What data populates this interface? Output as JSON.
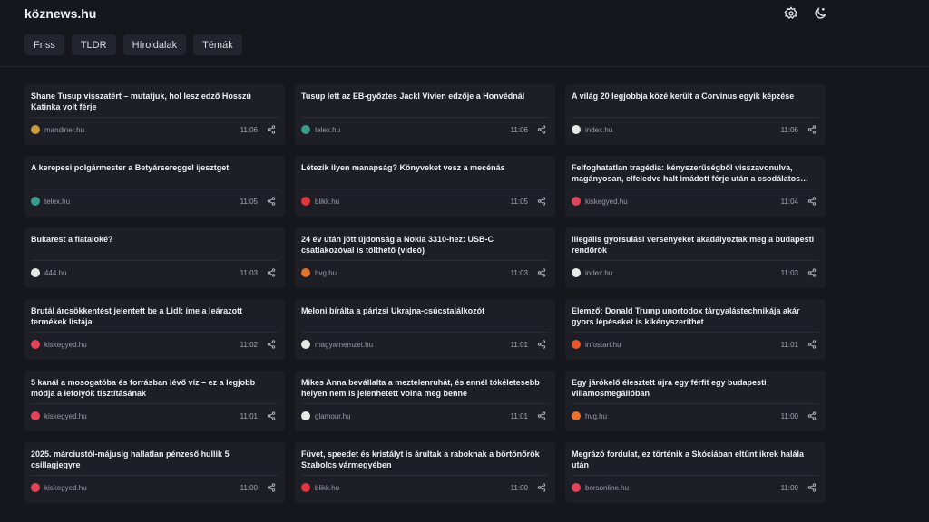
{
  "header": {
    "logo": "köznews.hu",
    "icons": [
      "settings-icon",
      "theme-toggle-icon"
    ]
  },
  "tabs": [
    {
      "label": "Friss"
    },
    {
      "label": "TLDR"
    },
    {
      "label": "Híroldalak"
    },
    {
      "label": "Témák"
    }
  ],
  "source_colors": {
    "mandiner.hu": "#c99a3a",
    "telex.hu": "#3a9b8c",
    "index.hu": "#e8e8e8",
    "blikk.hu": "#e0353b",
    "kiskegyed.hu": "#e0445a",
    "444.hu": "#e8e8e8",
    "hvg.hu": "#e8702a",
    "magyarnemzet.hu": "#e8e8e8",
    "infostart.hu": "#e8572a",
    "glamour.hu": "#e8e8e8",
    "borsonline.hu": "#e0445a"
  },
  "articles": [
    {
      "title": "Shane Tusup visszatért – mutatjuk, hol lesz edző Hosszú Katinka volt férje",
      "source": "mandiner.hu",
      "time": "11:06"
    },
    {
      "title": "Tusup lett az EB-győztes Jackl Vivien edzője a Honvédnál",
      "source": "telex.hu",
      "time": "11:06"
    },
    {
      "title": "A világ 20 legjobbja közé került a Corvinus egyik képzése",
      "source": "index.hu",
      "time": "11:06"
    },
    {
      "title": "A kerepesi polgármester a Betyársereggel ijesztget",
      "source": "telex.hu",
      "time": "11:05"
    },
    {
      "title": "Létezik ilyen manapság? Könyveket vesz a mecénás",
      "source": "blikk.hu",
      "time": "11:05"
    },
    {
      "title": "Felfoghatatlan tragédia: kényszerűségből visszavonulva, magányosan, elfeledve halt imádott férje után a csodálatos…",
      "source": "kiskegyed.hu",
      "time": "11:04"
    },
    {
      "title": "Bukarest a fiataloké?",
      "source": "444.hu",
      "time": "11:03"
    },
    {
      "title": "24 év után jött újdonság a Nokia 3310-hez: USB-C csatlakozóval is tölthető (videó)",
      "source": "hvg.hu",
      "time": "11:03"
    },
    {
      "title": "Illegális gyorsulási versenyeket akadályoztak meg a budapesti rendőrök",
      "source": "index.hu",
      "time": "11:03"
    },
    {
      "title": "Brutál árcsökkentést jelentett be a Lidl: íme a leárazott termékek listája",
      "source": "kiskegyed.hu",
      "time": "11:02"
    },
    {
      "title": "Meloni bírálta a párizsi Ukrajna-csúcstalálkozót",
      "source": "magyarnemzet.hu",
      "time": "11:01"
    },
    {
      "title": "Elemző: Donald Trump unortodox tárgyalástechnikája akár gyors lépéseket is kikényszeríthet",
      "source": "infostart.hu",
      "time": "11:01"
    },
    {
      "title": "5 kanál a mosogatóba és forrásban lévő víz – ez a legjobb módja a lefolyók tisztításának",
      "source": "kiskegyed.hu",
      "time": "11:01"
    },
    {
      "title": "Mikes Anna bevállalta a meztelenruhát, és ennél tökéletesebb helyen nem is jelenhetett volna meg benne",
      "source": "glamour.hu",
      "time": "11:01"
    },
    {
      "title": "Egy járókelő élesztett újra egy férfit egy budapesti villamosmegállóban",
      "source": "hvg.hu",
      "time": "11:00"
    },
    {
      "title": "2025. márciustól-májusig hallatlan pénzeső hullik 5 csillagjegyre",
      "source": "kiskegyed.hu",
      "time": "11:00"
    },
    {
      "title": "Füvet, speedet és kristályt is árultak a raboknak a börtönőrök Szabolcs vármegyében",
      "source": "blikk.hu",
      "time": "11:00"
    },
    {
      "title": "Megrázó fordulat, ez történik a Skóciában eltűnt ikrek halála után",
      "source": "borsonline.hu",
      "time": "11:00"
    }
  ]
}
